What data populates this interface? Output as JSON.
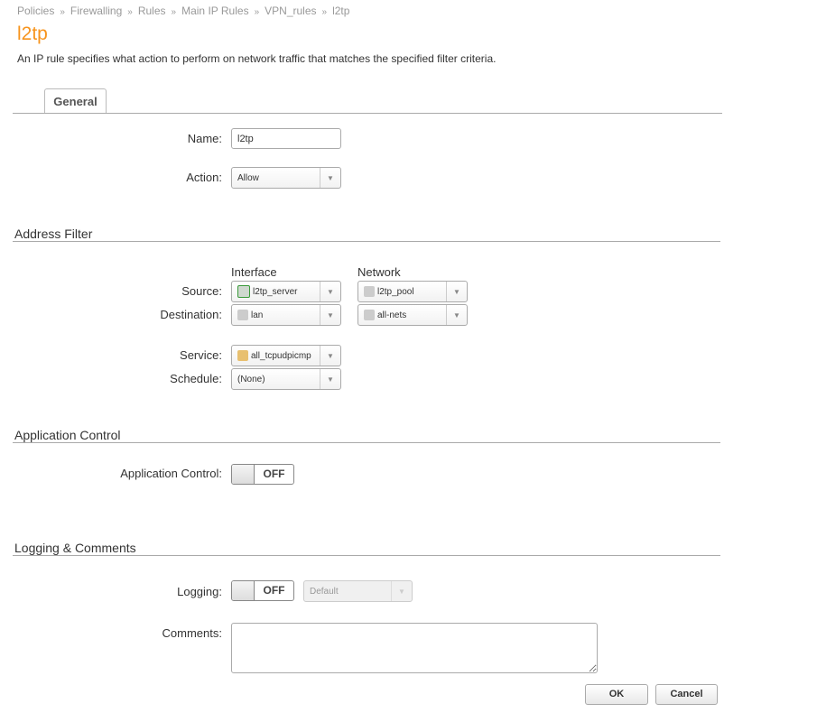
{
  "breadcrumb": [
    "Policies",
    "Firewalling",
    "Rules",
    "Main IP Rules",
    "VPN_rules",
    "l2tp"
  ],
  "breadcrumb_sep": "»",
  "title": "l2tp",
  "description": "An IP rule specifies what action to perform on network traffic that matches the specified filter criteria.",
  "tabs": [
    {
      "label": "General"
    }
  ],
  "general": {
    "name_label": "Name:",
    "name_value": "l2tp",
    "action_label": "Action:",
    "action_value": "Allow"
  },
  "address_filter": {
    "heading": "Address Filter",
    "interface_header": "Interface",
    "network_header": "Network",
    "source_label": "Source:",
    "source_interface": "l2tp_server",
    "source_network": "l2tp_pool",
    "destination_label": "Destination:",
    "destination_interface": "lan",
    "destination_network": "all-nets",
    "service_label": "Service:",
    "service_value": "all_tcpudpicmp",
    "schedule_label": "Schedule:",
    "schedule_value": "(None)"
  },
  "application_control": {
    "heading": "Application Control",
    "label": "Application Control:",
    "toggle": "OFF"
  },
  "logging": {
    "heading": "Logging & Comments",
    "logging_label": "Logging:",
    "toggle": "OFF",
    "severity_value": "Default",
    "comments_label": "Comments:",
    "comments_value": ""
  },
  "buttons": {
    "ok": "OK",
    "cancel": "Cancel"
  },
  "colors": {
    "accent": "#f7941d"
  }
}
